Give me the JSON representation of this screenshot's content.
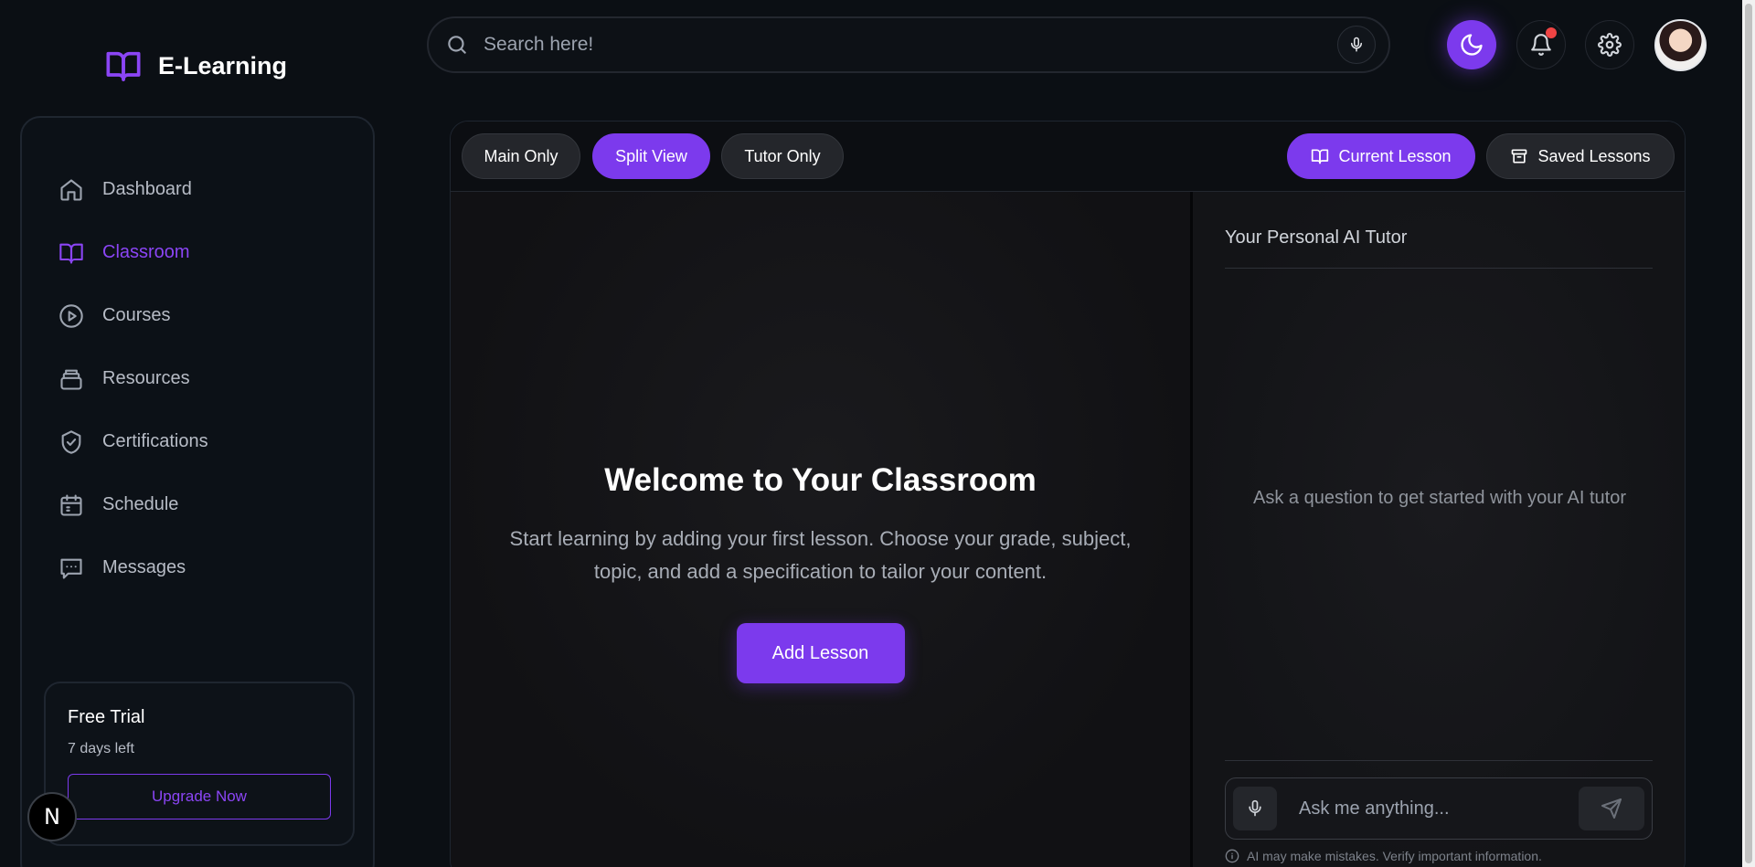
{
  "brand": {
    "title": "E-Learning",
    "icon": "book-open-icon"
  },
  "search": {
    "placeholder": "Search here!"
  },
  "header": {
    "icons": [
      "moon-icon",
      "bell-icon",
      "gear-icon",
      "avatar"
    ],
    "notification_dot": true
  },
  "sidebar": {
    "items": [
      {
        "label": "Dashboard",
        "icon": "home-icon",
        "active": false
      },
      {
        "label": "Classroom",
        "icon": "book-open-icon",
        "active": true
      },
      {
        "label": "Courses",
        "icon": "play-circle-icon",
        "active": false
      },
      {
        "label": "Resources",
        "icon": "layers-icon",
        "active": false
      },
      {
        "label": "Certifications",
        "icon": "badge-check-icon",
        "active": false
      },
      {
        "label": "Schedule",
        "icon": "calendar-icon",
        "active": false
      },
      {
        "label": "Messages",
        "icon": "message-icon",
        "active": false
      }
    ],
    "trial": {
      "title": "Free Trial",
      "subtitle": "7 days left",
      "button": "Upgrade Now"
    },
    "badge": "N"
  },
  "toolbar": {
    "view_modes": [
      {
        "label": "Main Only",
        "active": false
      },
      {
        "label": "Split View",
        "active": true
      },
      {
        "label": "Tutor Only",
        "active": false
      }
    ],
    "current_lesson": "Current Lesson",
    "saved_lessons": "Saved Lessons"
  },
  "main": {
    "welcome_title": "Welcome to Your Classroom",
    "welcome_text": "Start learning by adding your first lesson. Choose your grade, subject, topic, and add a specification to tailor your content.",
    "add_button": "Add Lesson"
  },
  "tutor": {
    "title": "Your Personal AI Tutor",
    "empty_text": "Ask a question to get started with your AI tutor",
    "input_placeholder": "Ask me anything...",
    "disclaimer": "AI may make mistakes. Verify important information."
  },
  "colors": {
    "accent": "#7c3aed",
    "accent_text": "#8b45f5",
    "background": "#0b0f14",
    "notification": "#ef4444"
  }
}
